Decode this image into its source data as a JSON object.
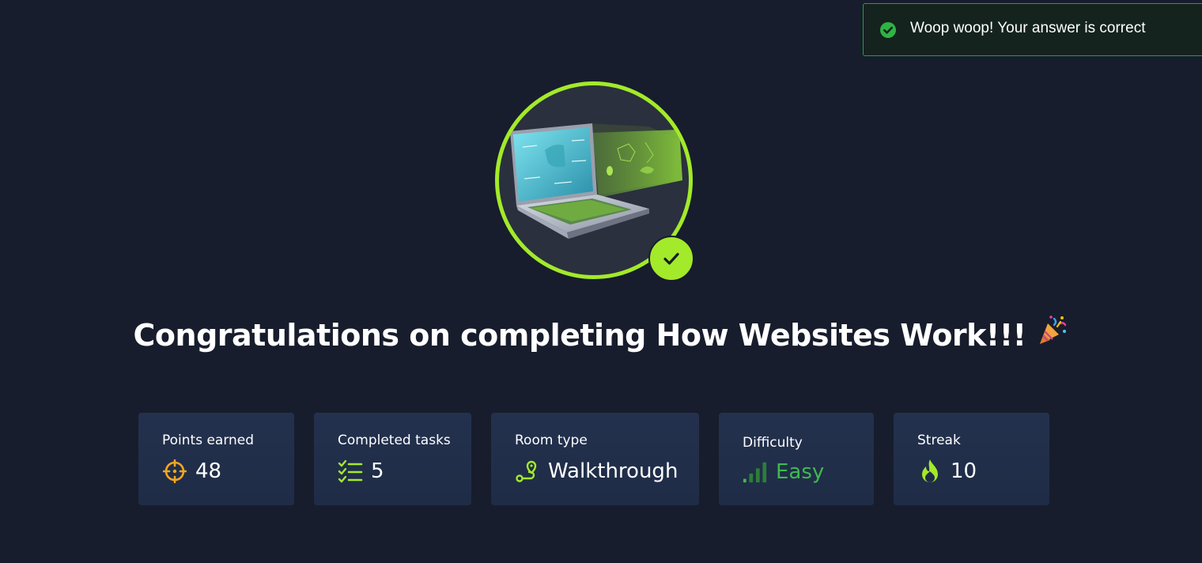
{
  "toast": {
    "message": "Woop woop! Your answer is correct",
    "status_color": "#2e9c3c"
  },
  "badge": {
    "image": "laptop-illustration",
    "ring_color": "#a3ea2a",
    "completed": true
  },
  "title": {
    "text": "Congratulations on completing How Websites Work!!!",
    "emoji": "party-popper-icon"
  },
  "stats": [
    {
      "label": "Points earned",
      "value": "48",
      "icon": "crosshair-icon",
      "icon_color": "#f5a623"
    },
    {
      "label": "Completed tasks",
      "value": "5",
      "icon": "checklist-icon",
      "icon_color": "#a3ea2a"
    },
    {
      "label": "Room type",
      "value": "Walkthrough",
      "icon": "route-icon",
      "icon_color": "#a3ea2a"
    },
    {
      "label": "Difficulty",
      "value": "Easy",
      "icon": "signal-bars-icon",
      "icon_color": "#3fb950"
    },
    {
      "label": "Streak",
      "value": "10",
      "icon": "flame-icon",
      "icon_color": "#a3ea2a"
    }
  ]
}
